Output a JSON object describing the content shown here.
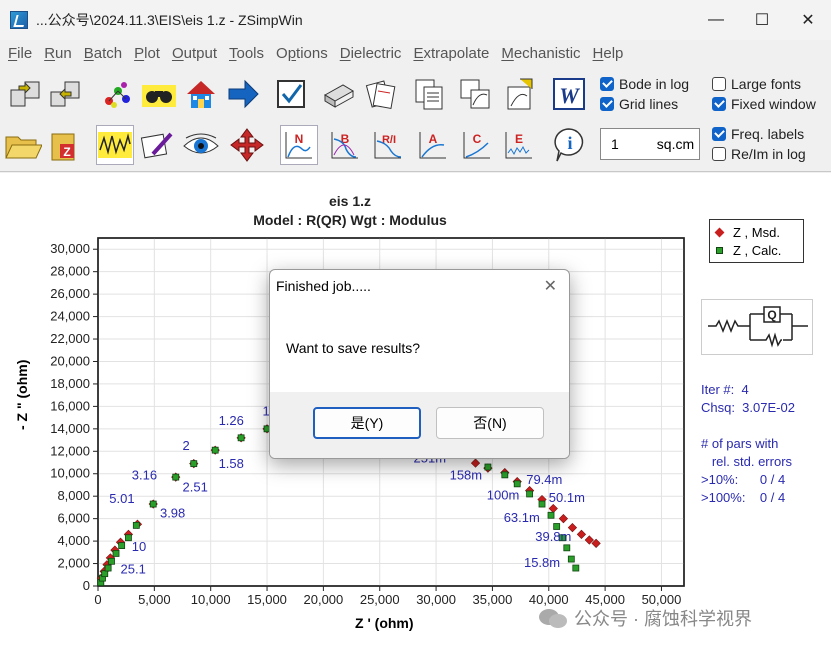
{
  "window": {
    "title": "...公众号\\2024.11.3\\EIS\\eis 1.z - ZSimpWin"
  },
  "menu": [
    "File",
    "Run",
    "Batch",
    "Plot",
    "Output",
    "Tools",
    "Options",
    "Dielectric",
    "Extrapolate",
    "Mechanistic",
    "Help"
  ],
  "menu_underline": [
    "F",
    "R",
    "B",
    "P",
    "O",
    "T",
    "p",
    "D",
    "E",
    "M",
    "H"
  ],
  "options": {
    "bode_in_log": "Bode in log",
    "grid_lines": "Grid lines",
    "large_fonts": "Large fonts",
    "fixed_window": "Fixed window",
    "freq_labels": "Freq. labels",
    "re_im_in_log": "Re/Im in log"
  },
  "area": {
    "value": "1",
    "unit": "sq.cm"
  },
  "plot": {
    "title": "eis 1.z",
    "subtitle": "Model : R(QR)     Wgt : Modulus"
  },
  "legend": {
    "measured": "Z ,  Msd.",
    "calculated": "Z ,  Calc."
  },
  "info": {
    "iter": "Iter #:  4",
    "chsq": "Chsq:  3.07E-02",
    "pars1": "# of pars with",
    "pars2": "   rel. std. errors",
    "gt10": ">10%:      0 / 4",
    "gt100": ">100%:    0 / 4"
  },
  "dialog": {
    "title": "Finished job.....",
    "message": "Want to save results?",
    "yes": "是(Y)",
    "no": "否(N)"
  },
  "watermark": "公众号 · 腐蚀科学视界",
  "colors": {
    "measured": "#c81e1e",
    "calculated": "#2aa02a",
    "freq_label": "#2a2ab0"
  },
  "chart_data": {
    "type": "scatter",
    "xlabel": "Z ' (ohm)",
    "ylabel": "- Z \" (ohm)",
    "xlim": [
      0,
      52000
    ],
    "ylim": [
      0,
      31000
    ],
    "xticks": [
      "0",
      "5,000",
      "10,000",
      "15,000",
      "20,000",
      "25,000",
      "30,000",
      "35,000",
      "40,000",
      "45,000",
      "50,000"
    ],
    "yticks": [
      "0",
      "2,000",
      "4,000",
      "6,000",
      "8,000",
      "10,000",
      "12,000",
      "14,000",
      "16,000",
      "18,000",
      "20,000",
      "22,000",
      "24,000",
      "26,000",
      "28,000",
      "30,000"
    ],
    "series": [
      {
        "name": "Z , Msd.",
        "x": [
          300,
          550,
          800,
          1100,
          1500,
          2000,
          2700,
          3500,
          4900,
          6900,
          8500,
          10400,
          12700,
          15000,
          33500,
          34600,
          36100,
          37200,
          38300,
          39400,
          40400,
          41300,
          42100,
          42900,
          43600,
          44200
        ],
        "y": [
          700,
          1300,
          1900,
          2500,
          3200,
          3900,
          4600,
          5500,
          7300,
          9700,
          10900,
          12100,
          13200,
          14000,
          10950,
          10500,
          10100,
          9300,
          8500,
          7700,
          6900,
          6000,
          5200,
          4600,
          4100,
          3800
        ]
      },
      {
        "name": "Z , Calc.",
        "x": [
          250,
          400,
          600,
          900,
          1200,
          1600,
          2100,
          2700,
          3400,
          4900,
          6900,
          8500,
          10400,
          12700,
          15000,
          34600,
          36100,
          37200,
          38300,
          39400,
          40200,
          40700,
          41200,
          41600,
          42000,
          42400
        ],
        "y": [
          300,
          700,
          1100,
          1600,
          2200,
          2900,
          3600,
          4300,
          5400,
          7300,
          9700,
          10900,
          12100,
          13200,
          14000,
          10600,
          9900,
          9100,
          8200,
          7300,
          6300,
          5300,
          4300,
          3400,
          2400,
          1600
        ]
      }
    ],
    "freq_labels": [
      {
        "text": "1.26",
        "x": 10700,
        "y": 14350
      },
      {
        "text": "1",
        "x": 14600,
        "y": 15200
      },
      {
        "text": "2",
        "x": 7500,
        "y": 12100
      },
      {
        "text": "1.58",
        "x": 10700,
        "y": 10500
      },
      {
        "text": "3.16",
        "x": 3000,
        "y": 9500
      },
      {
        "text": "2.51",
        "x": 7500,
        "y": 8400
      },
      {
        "text": "5.01",
        "x": 1000,
        "y": 7400
      },
      {
        "text": "3.98",
        "x": 5500,
        "y": 6100
      },
      {
        "text": "10",
        "x": 3000,
        "y": 3100
      },
      {
        "text": "25.1",
        "x": 2000,
        "y": 1100
      },
      {
        "text": "251m",
        "x": 28000,
        "y": 11000
      },
      {
        "text": "126m",
        "x": 35400,
        "y": 11300
      },
      {
        "text": "158m",
        "x": 31200,
        "y": 9500
      },
      {
        "text": "79.4m",
        "x": 38000,
        "y": 9100
      },
      {
        "text": "100m",
        "x": 34500,
        "y": 7700
      },
      {
        "text": "50.1m",
        "x": 40000,
        "y": 7500
      },
      {
        "text": "63.1m",
        "x": 36000,
        "y": 5700
      },
      {
        "text": "39.8m",
        "x": 38800,
        "y": 4000
      },
      {
        "text": "15.8m",
        "x": 37800,
        "y": 1700
      }
    ]
  }
}
